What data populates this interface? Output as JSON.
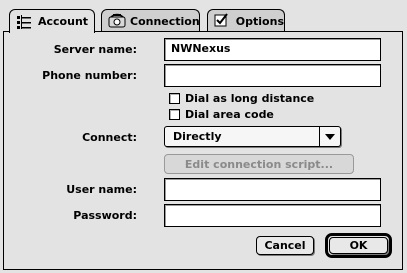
{
  "tabs": [
    {
      "label": "Account",
      "icon": "account-icon",
      "active": true
    },
    {
      "label": "Connection",
      "icon": "connection-icon",
      "active": false
    },
    {
      "label": "Options",
      "icon": "options-icon",
      "active": false
    }
  ],
  "form": {
    "server_name_label": "Server name:",
    "server_name_value": "NWNexus",
    "phone_number_label": "Phone number:",
    "phone_number_value": "",
    "dial_long_distance_label": "Dial as long distance",
    "dial_area_code_label": "Dial area code",
    "connect_label": "Connect:",
    "connect_value": "Directly",
    "edit_script_label": "Edit connection script...",
    "user_name_label": "User name:",
    "user_name_value": "",
    "password_label": "Password:",
    "password_value": ""
  },
  "buttons": {
    "cancel_label": "Cancel",
    "ok_label": "OK"
  }
}
